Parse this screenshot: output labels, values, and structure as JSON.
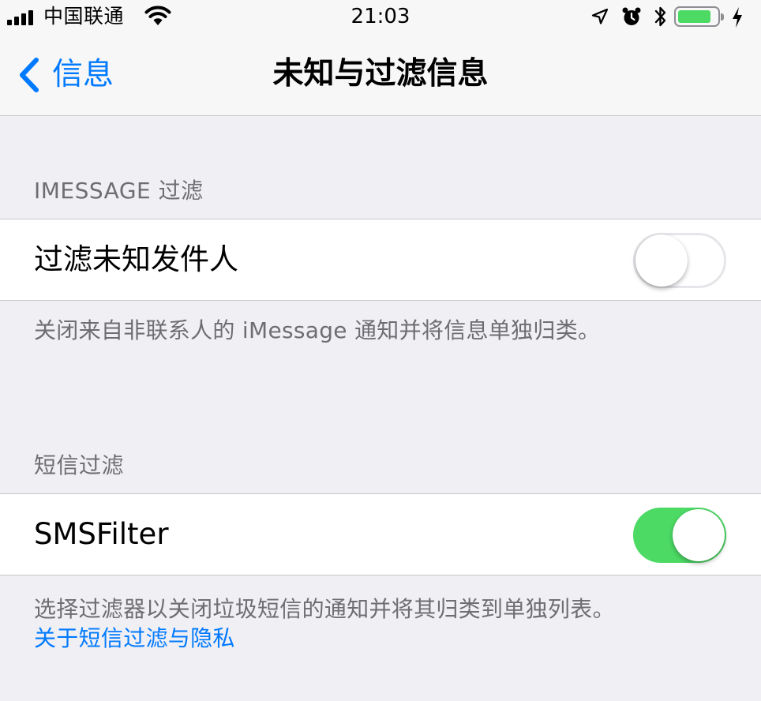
{
  "status_bar": {
    "carrier": "中国联通",
    "time": "21:03",
    "battery_level": 0.9,
    "battery_color": "#4cd964",
    "icons": [
      "signal-icon",
      "wifi-icon",
      "location-icon",
      "alarm-icon",
      "bluetooth-icon",
      "battery-icon",
      "charging-icon"
    ]
  },
  "nav": {
    "back_label": "信息",
    "title": "未知与过滤信息",
    "accent_color": "#007aff"
  },
  "sections": {
    "imessage": {
      "header": "IMESSAGE 过滤",
      "row_label": "过滤未知发件人",
      "toggle_on": false,
      "footer": "关闭来自非联系人的 iMessage 通知并将信息单独归类。"
    },
    "sms": {
      "header": "短信过滤",
      "row_label": "SMSFilter",
      "toggle_on": true,
      "footer": "选择过滤器以关闭垃圾短信的通知并将其归类到单独列表。",
      "link": "关于短信过滤与隐私"
    }
  },
  "colors": {
    "toggle_on": "#4cd964",
    "background": "#efeff4",
    "link": "#007aff"
  }
}
